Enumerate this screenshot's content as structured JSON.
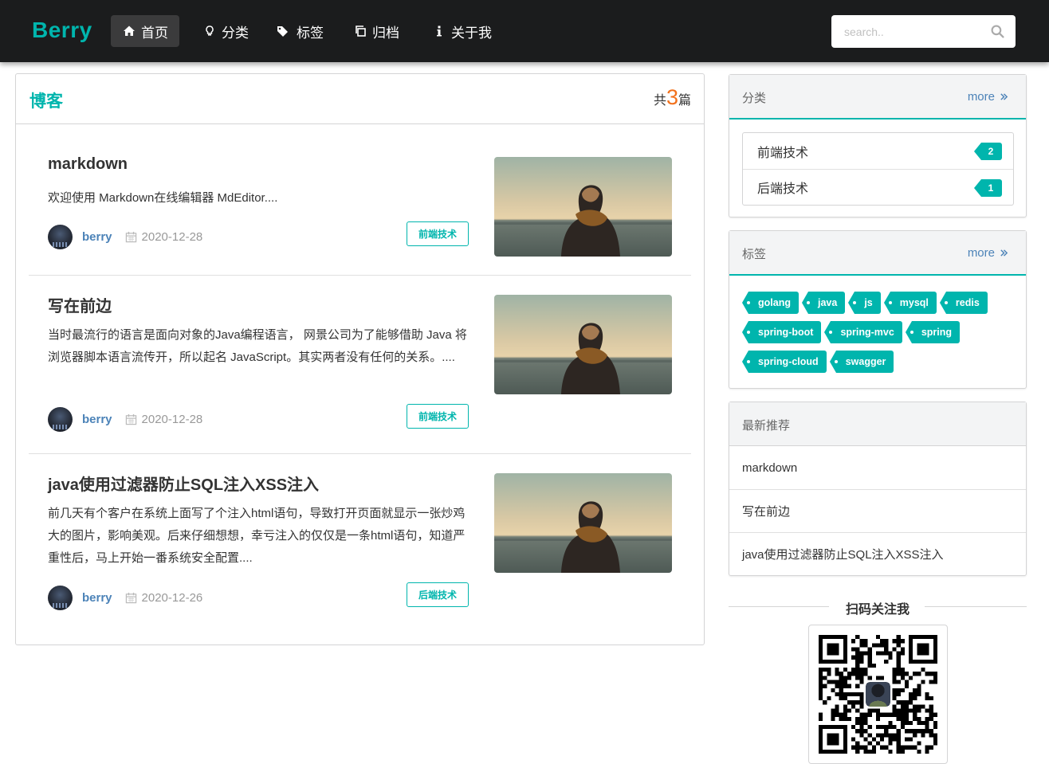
{
  "brand": "Berry",
  "nav": {
    "items": [
      {
        "label": "首页",
        "icon": "home-icon"
      },
      {
        "label": "分类",
        "icon": "lightbulb-icon"
      },
      {
        "label": "标签",
        "icon": "tags-icon"
      },
      {
        "label": "归档",
        "icon": "clone-icon"
      },
      {
        "label": "关于我",
        "icon": "info-icon"
      }
    ],
    "search_placeholder": "search.."
  },
  "blog": {
    "title": "博客",
    "count_prefix": "共",
    "count": "3",
    "count_suffix": "篇",
    "posts": [
      {
        "title": "markdown",
        "excerpt": "欢迎使用 Markdown在线编辑器 MdEditor....",
        "author": "berry",
        "date": "2020-12-28",
        "category": "前端技术"
      },
      {
        "title": "写在前边",
        "excerpt": "当时最流行的语言是面向对象的Java编程语言， 网景公司为了能够借助 Java 将浏览器脚本语言流传开，所以起名 JavaScript。其实两者没有任何的关系。....",
        "author": "berry",
        "date": "2020-12-28",
        "category": "前端技术"
      },
      {
        "title": "java使用过滤器防止SQL注入XSS注入",
        "excerpt": "前几天有个客户在系统上面写了个注入html语句，导致打开页面就显示一张炒鸡大的图片，影响美观。后来仔细想想，幸亏注入的仅仅是一条html语句，知道严重性后，马上开始一番系统安全配置....",
        "author": "berry",
        "date": "2020-12-26",
        "category": "后端技术"
      }
    ]
  },
  "sidebar": {
    "categories": {
      "title": "分类",
      "more": "more",
      "items": [
        {
          "name": "前端技术",
          "count": "2"
        },
        {
          "name": "后端技术",
          "count": "1"
        }
      ]
    },
    "tags": {
      "title": "标签",
      "more": "more",
      "items": [
        "golang",
        "java",
        "js",
        "mysql",
        "redis",
        "spring-boot",
        "spring-mvc",
        "spring",
        "spring-cloud",
        "swagger"
      ]
    },
    "recommend": {
      "title": "最新推荐",
      "items": [
        "markdown",
        "写在前边",
        "java使用过滤器防止SQL注入XSS注入"
      ]
    },
    "qr": {
      "title": "扫码关注我"
    }
  },
  "colors": {
    "accent": "#00b5ad",
    "nav_bg": "#1b1c1d",
    "count_orange": "#f2711c",
    "author_blue": "#4c83b8"
  }
}
